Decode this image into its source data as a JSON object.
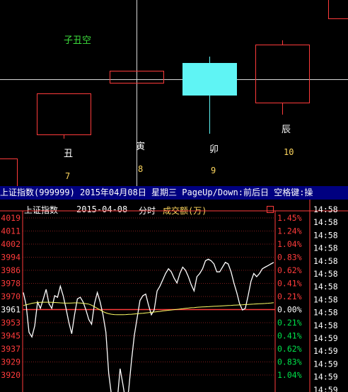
{
  "top_panel": {
    "indicator_label": "子丑空",
    "branches": [
      {
        "name": "丑",
        "number": "7"
      },
      {
        "name": "寅",
        "number": "8"
      },
      {
        "name": "卯",
        "number": "9"
      },
      {
        "name": "辰",
        "number": "10"
      }
    ]
  },
  "title_bar": {
    "text": "上证指数(999999) 2015年04月08日 星期三 PageUp/Down:前后日 空格键:操"
  },
  "chart_header": {
    "name": "上证指数",
    "date": "2015-04-08",
    "mode": "分时",
    "volume_label": "成交额(万)"
  },
  "chart_data": {
    "type": "line",
    "y_axis_left": [
      "4019",
      "4011",
      "4002",
      "3994",
      "3986",
      "3978",
      "3970",
      "3961",
      "3953",
      "3945",
      "3937",
      "3929",
      "3920"
    ],
    "y_axis_right": [
      "1.45%",
      "1.24%",
      "1.04%",
      "0.83%",
      "0.62%",
      "0.41%",
      "0.21%",
      "0.00%",
      "0.21%",
      "0.41%",
      "0.62%",
      "0.83%",
      "1.04%"
    ],
    "reference_value": 3961,
    "ylim": [
      3915,
      4023
    ],
    "time_labels": [
      "14:58",
      "14:58",
      "14:58",
      "14:58",
      "14:58",
      "14:58",
      "14:58",
      "14:58",
      "14:58",
      "14:58",
      "14:59",
      "14:59",
      "14:59",
      "14:59",
      "14:59"
    ],
    "series": [
      {
        "color": "#ffffff",
        "values": [
          3972,
          3964,
          3947,
          3944,
          3951,
          3966,
          3962,
          3968,
          3974,
          3965,
          3962,
          3970,
          3969,
          3976,
          3970,
          3962,
          3953,
          3946,
          3958,
          3968,
          3969,
          3966,
          3961,
          3955,
          3952,
          3965,
          3972,
          3966,
          3958,
          3947,
          3921,
          3907,
          3898,
          3904,
          3924,
          3914,
          3903,
          3910,
          3929,
          3945,
          3956,
          3967,
          3970,
          3971,
          3964,
          3958,
          3961,
          3973,
          3976,
          3980,
          3984,
          3987,
          3985,
          3981,
          3978,
          3984,
          3988,
          3986,
          3982,
          3977,
          3973,
          3982,
          3984,
          3987,
          3992,
          3993,
          3992,
          3990,
          3985,
          3985,
          3988,
          3991,
          3990,
          3985,
          3978,
          3972,
          3965,
          3961,
          3962,
          3970,
          3979,
          3984,
          3982,
          3984,
          3987,
          3988,
          3989,
          3990,
          3991
        ],
        "color_name": "white"
      },
      {
        "color": "#ffff66",
        "values": [
          3963.8,
          3964.3,
          3964.7,
          3965.2,
          3965.5,
          3965.7,
          3965.8,
          3965.9,
          3965.9,
          3965.9,
          3965.8,
          3965.7,
          3965.6,
          3965.5,
          3965.4,
          3965.3,
          3965.3,
          3965.4,
          3965.5,
          3965.5,
          3965.4,
          3965.2,
          3965.0,
          3964.7,
          3964.0,
          3963.0,
          3962.0,
          3961.0,
          3960.0,
          3959.2,
          3958.6,
          3958.3,
          3958.1,
          3958.0,
          3958.0,
          3958.0,
          3958.1,
          3958.2,
          3958.3,
          3958.5,
          3958.6,
          3958.8,
          3958.9,
          3959.1,
          3959.3,
          3959.5,
          3959.7,
          3959.9,
          3960.1,
          3960.4,
          3960.6,
          3960.8,
          3961.0,
          3961.2,
          3961.4,
          3961.6,
          3961.8,
          3962.0,
          3962.2,
          3962.4,
          3962.5,
          3962.7,
          3962.8,
          3962.9,
          3963.0,
          3963.1,
          3963.2,
          3963.3,
          3963.4,
          3963.5,
          3963.6,
          3963.7,
          3963.8,
          3963.9,
          3964.0,
          3964.1,
          3964.2,
          3964.3,
          3964.4,
          3964.5,
          3964.6,
          3964.7,
          3964.8,
          3964.9,
          3965.0,
          3965.1,
          3965.2,
          3965.4,
          3965.6
        ]
      }
    ]
  },
  "colors": {
    "up": "#ff3b3b",
    "down": "#00e04a",
    "cyan_candle": "#5ff4f4",
    "title_bg": "#000080",
    "indicator": "#3cdc3c"
  }
}
